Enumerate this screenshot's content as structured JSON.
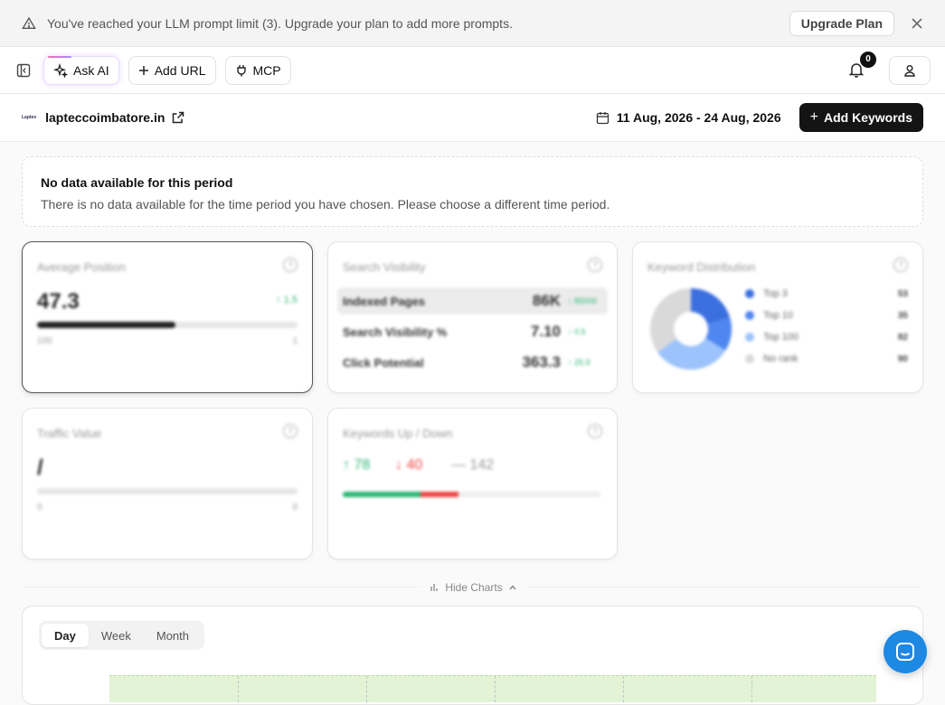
{
  "banner": {
    "message": "You've reached your LLM prompt limit (3). Upgrade your plan to add more prompts.",
    "upgrade_label": "Upgrade Plan"
  },
  "topbar": {
    "ask_ai_label": "Ask AI",
    "add_url_label": "Add URL",
    "mcp_label": "MCP",
    "notification_count": "0"
  },
  "site": {
    "logo_text": "Laptee",
    "domain": "lapteccoimbatore.in",
    "date_range": "11 Aug, 2026 - 24 Aug, 2026",
    "add_keywords_label": "Add Keywords"
  },
  "notice": {
    "title": "No data available for this period",
    "description": "There is no data available for the time period you have chosen. Please choose a different time period."
  },
  "cards": {
    "help_glyph": "?",
    "average_position": {
      "title": "Average Position",
      "value": "47.3",
      "change": "↑ 1.5",
      "progress": 0.53,
      "axis_min": "100",
      "axis_max": "1"
    },
    "search_visibility": {
      "title": "Search Visibility",
      "rows": [
        {
          "label": "Indexed Pages",
          "value": "86K",
          "change": "↑ 85000"
        },
        {
          "label": "Search Visibility %",
          "value": "7.10",
          "change": "↑ 0.5"
        },
        {
          "label": "Click Potential",
          "value": "363.3",
          "change": "↑ 25.9"
        }
      ]
    },
    "keyword_distribution": {
      "title": "Keyword Distribution",
      "items": [
        {
          "name": "Top 3",
          "count": "53",
          "color": "#3b6fe0"
        },
        {
          "name": "Top 10",
          "count": "35",
          "color": "#4f86f0"
        },
        {
          "name": "Top 100",
          "count": "82",
          "color": "#9cc3fb"
        },
        {
          "name": "No rank",
          "count": "90",
          "color": "#d9d9d9"
        }
      ]
    },
    "traffic_value": {
      "title": "Traffic Value",
      "value": "/",
      "axis_min": "0",
      "axis_max": "0"
    },
    "keywords_up_down": {
      "title": "Keywords Up / Down",
      "up": "↑ 78",
      "down": "↓ 40",
      "neutral": "— 142",
      "up_color": "#2bb673",
      "down_color": "#ef4444",
      "neutral_color": "#999999",
      "up_fraction": 0.3,
      "down_fraction": 0.15
    }
  },
  "charts": {
    "hide_label": "Hide Charts",
    "periods": [
      "Day",
      "Week",
      "Month"
    ],
    "selected_period": "Day"
  }
}
